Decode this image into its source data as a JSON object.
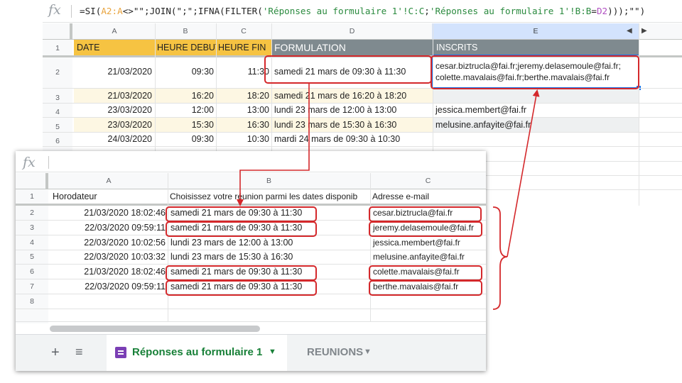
{
  "formula_bar": {
    "fx_label": "fx",
    "formula_prefix": "=SI(",
    "formula_ref1": "A2:A",
    "formula_mid1": "<>\"\";JOIN(\";\";IFNA(FILTER(",
    "formula_ref2": "'Réponses au formulaire 1'!C:C",
    "formula_mid2": ";",
    "formula_ref3": "'Réponses au formulaire 1'!B:B",
    "formula_mid3": "=",
    "formula_ref4": "D2",
    "formula_suffix": ")));\"\")"
  },
  "reunions_sheet": {
    "columns": [
      "A",
      "B",
      "C",
      "D",
      "E"
    ],
    "header_row": [
      "DATE",
      "HEURE DEBUT",
      "HEURE FIN",
      "FORMULATION",
      "INSCRITS"
    ],
    "row_numbers": [
      "1",
      "2",
      "3",
      "4",
      "5",
      "6"
    ],
    "rows": [
      {
        "date": "21/03/2020",
        "start": "09:30",
        "end": "11:30",
        "formulation": "samedi 21 mars de 09:30 à 11:30",
        "inscrits_line1": "cesar.biztrucla@fai.fr;jeremy.delasemoule@fai.fr;",
        "inscrits_line2": "colette.mavalais@fai.fr;berthe.mavalais@fai.fr"
      },
      {
        "date": "21/03/2020",
        "start": "16:20",
        "end": "18:20",
        "formulation": "samedi 21 mars de 16:20 à 18:20",
        "inscrits_line1": "",
        "inscrits_line2": ""
      },
      {
        "date": "23/03/2020",
        "start": "12:00",
        "end": "13:00",
        "formulation": "lundi 23 mars de 12:00 à 13:00",
        "inscrits_line1": "jessica.membert@fai.fr",
        "inscrits_line2": ""
      },
      {
        "date": "23/03/2020",
        "start": "15:30",
        "end": "16:30",
        "formulation": "lundi 23 mars de 15:30 à 16:30",
        "inscrits_line1": "melusine.anfayite@fai.fr",
        "inscrits_line2": ""
      },
      {
        "date": "24/03/2020",
        "start": "09:30",
        "end": "10:30",
        "formulation": "mardi 24 mars de 09:30 à 10:30",
        "inscrits_line1": "",
        "inscrits_line2": ""
      }
    ],
    "colors": {
      "date_header": "#f6c342",
      "formulation_header": "#7f8a8f",
      "alt_row": "#fdf7e3",
      "alt_row_gray": "#eef0f1"
    }
  },
  "responses_sheet": {
    "fx_label": "fx",
    "columns": [
      "A",
      "B",
      "C"
    ],
    "header_row": [
      "Horodateur",
      "Choisissez votre réunion parmi les dates disponib",
      "Adresse e-mail"
    ],
    "row_numbers": [
      "1",
      "2",
      "3",
      "4",
      "5",
      "6",
      "7",
      "8"
    ],
    "rows": [
      {
        "ts": "21/03/2020 18:02:46",
        "choice": "samedi 21 mars de 09:30 à 11:30",
        "email": "cesar.biztrucla@fai.fr"
      },
      {
        "ts": "22/03/2020 09:59:11",
        "choice": "samedi 21 mars de 09:30 à 11:30",
        "email": "jeremy.delasemoule@fai.fr"
      },
      {
        "ts": "22/03/2020 10:02:56",
        "choice": "lundi 23 mars de 12:00 à 13:00",
        "email": "jessica.membert@fai.fr"
      },
      {
        "ts": "22/03/2020 10:03:32",
        "choice": "lundi 23 mars de 15:30 à 16:30",
        "email": "melusine.anfayite@fai.fr"
      },
      {
        "ts": "21/03/2020 18:02:46",
        "choice": "samedi 21 mars de 09:30 à 11:30",
        "email": "colette.mavalais@fai.fr"
      },
      {
        "ts": "22/03/2020 09:59:11",
        "choice": "samedi 21 mars de 09:30 à 11:30",
        "email": "berthe.mavalais@fai.fr"
      }
    ]
  },
  "tabs": {
    "add_icon": "+",
    "list_icon": "≡",
    "active_label": "Réponses au formulaire 1",
    "active_caret": "▼",
    "inactive_label": "REUNIONS",
    "inactive_caret": "▼"
  },
  "annotation_color": "#d4282b"
}
